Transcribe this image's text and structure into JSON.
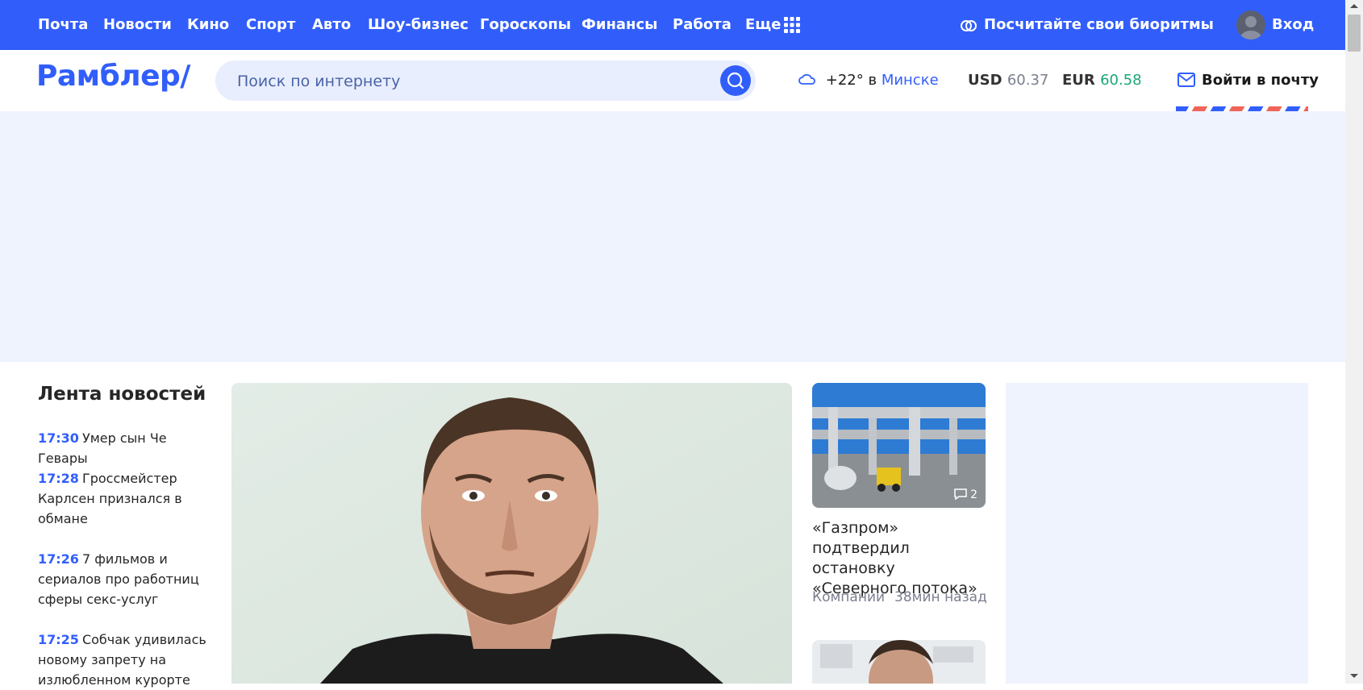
{
  "topnav": {
    "items": [
      "Почта",
      "Новости",
      "Кино",
      "Спорт",
      "Авто",
      "Шоу-бизнес",
      "Гороскопы",
      "Финансы",
      "Работа",
      "Еще"
    ],
    "biorhythm": "Посчитайте свои биоритмы",
    "login": "Вход"
  },
  "header": {
    "logo": "Рамблер/",
    "search_placeholder": "Поиск по интернету",
    "weather": {
      "temp": "+22°",
      "prep": "в",
      "city": "Минске"
    },
    "usd": {
      "code": "USD",
      "value": "60.37",
      "color": "#7a7f8f"
    },
    "eur": {
      "code": "EUR",
      "value": "60.58",
      "color": "#1aa57a"
    },
    "mail": "Войти в почту"
  },
  "feed": {
    "title": "Лента новостей",
    "items": [
      {
        "time": "17:30",
        "text": "Умер сын Че Гевары"
      },
      {
        "time": "17:28",
        "text": "Гроссмейстер Карлсен признался в обмане"
      },
      {
        "time": "17:26",
        "text": "7 фильмов и сериалов про работниц сферы секс-услуг"
      },
      {
        "time": "17:25",
        "text": "Собчак удивилась новому запрету на излюбленном курорте"
      }
    ]
  },
  "card": {
    "title": "«Газпром» подтвердил остановку «Северного потока»",
    "category": "Компании",
    "age": "38мин назад",
    "comments": "2"
  },
  "colors": {
    "brand": "#315efb",
    "banner_bg": "#eff3fe"
  }
}
